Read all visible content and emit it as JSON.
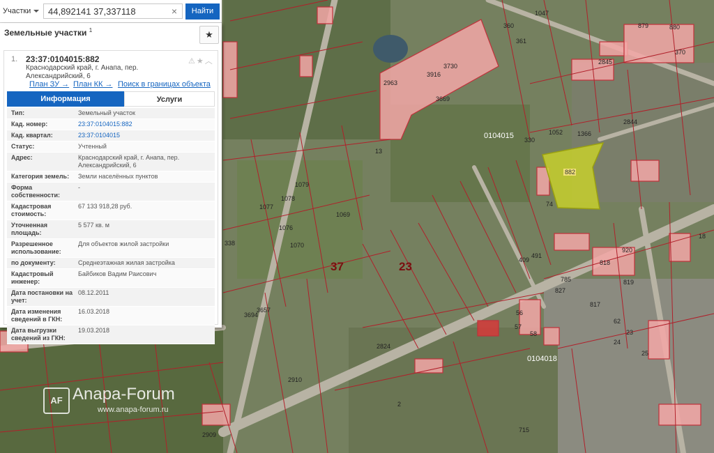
{
  "search": {
    "type_label": "Участки",
    "query": "44,892141 37,337118",
    "clear_glyph": "×",
    "button_label": "Найти"
  },
  "panel": {
    "title": "Земельные участки",
    "count": "1",
    "star_glyph": "★",
    "item": {
      "index": "1.",
      "cadastral_number": "23:37:0104015:882",
      "address_short": "Краснодарский край, г. Анапа, пер. Александрийский, 6",
      "icons": "⚠★︿",
      "links": {
        "plan_zu": "План ЗУ →",
        "plan_kk": "План КК →",
        "search_bounds": "Поиск в границах объекта →"
      },
      "tabs": {
        "info": "Информация",
        "services": "Услуги"
      },
      "attributes": [
        {
          "label": "Тип:",
          "value": "Земельный участок"
        },
        {
          "label": "Кад. номер:",
          "value": "23:37:0104015:882",
          "link": true
        },
        {
          "label": "Кад. квартал:",
          "value": "23:37:0104015",
          "link": true
        },
        {
          "label": "Статус:",
          "value": "Учтенный"
        },
        {
          "label": "Адрес:",
          "value": "Краснодарский край, г. Анапа, пер. Александрийский, 6"
        },
        {
          "label": "Категория земель:",
          "value": "Земли населённых пунктов"
        },
        {
          "label": "Форма собственности:",
          "value": "-"
        },
        {
          "label": "Кадастровая стоимость:",
          "value": "67 133 918,28 руб."
        },
        {
          "label": "Уточненная площадь:",
          "value": "5 577 кв. м"
        },
        {
          "label": "Разрешенное использование:",
          "value": "Для объектов жилой застройки"
        },
        {
          "label": "по документу:",
          "value": "Среднеэтажная жилая застройка"
        },
        {
          "label": "Кадастровый инженер:",
          "value": "Байбиков Вадим Раисович"
        },
        {
          "label": "Дата постановки на учет:",
          "value": "08.12.2011"
        },
        {
          "label": "Дата изменения сведений в ГКН:",
          "value": "16.03.2018"
        },
        {
          "label": "Дата выгрузки сведений из ГКН:",
          "value": "19.03.2018"
        }
      ]
    }
  },
  "map": {
    "quarter_labels": [
      "0104015",
      "0104018"
    ],
    "big_labels": [
      "37",
      "23"
    ],
    "selected_parcel": "882",
    "parcel_labels": [
      "2963",
      "3916",
      "3730",
      "3669",
      "1047",
      "2845",
      "2844",
      "1052",
      "1366",
      "1069",
      "1070",
      "1076",
      "1077",
      "1078",
      "1079",
      "2910",
      "2909",
      "2824",
      "3694",
      "3657",
      "409",
      "491",
      "920",
      "818",
      "785",
      "827",
      "817",
      "819",
      "338",
      "360",
      "361",
      "370",
      "879",
      "880",
      "62",
      "23",
      "24",
      "25",
      "18",
      "56",
      "57",
      "58",
      "715",
      "13",
      "330",
      "74",
      "2"
    ]
  },
  "watermark": {
    "logo": "AF",
    "title": "Anapa-Forum",
    "url": "www.anapa-forum.ru"
  }
}
